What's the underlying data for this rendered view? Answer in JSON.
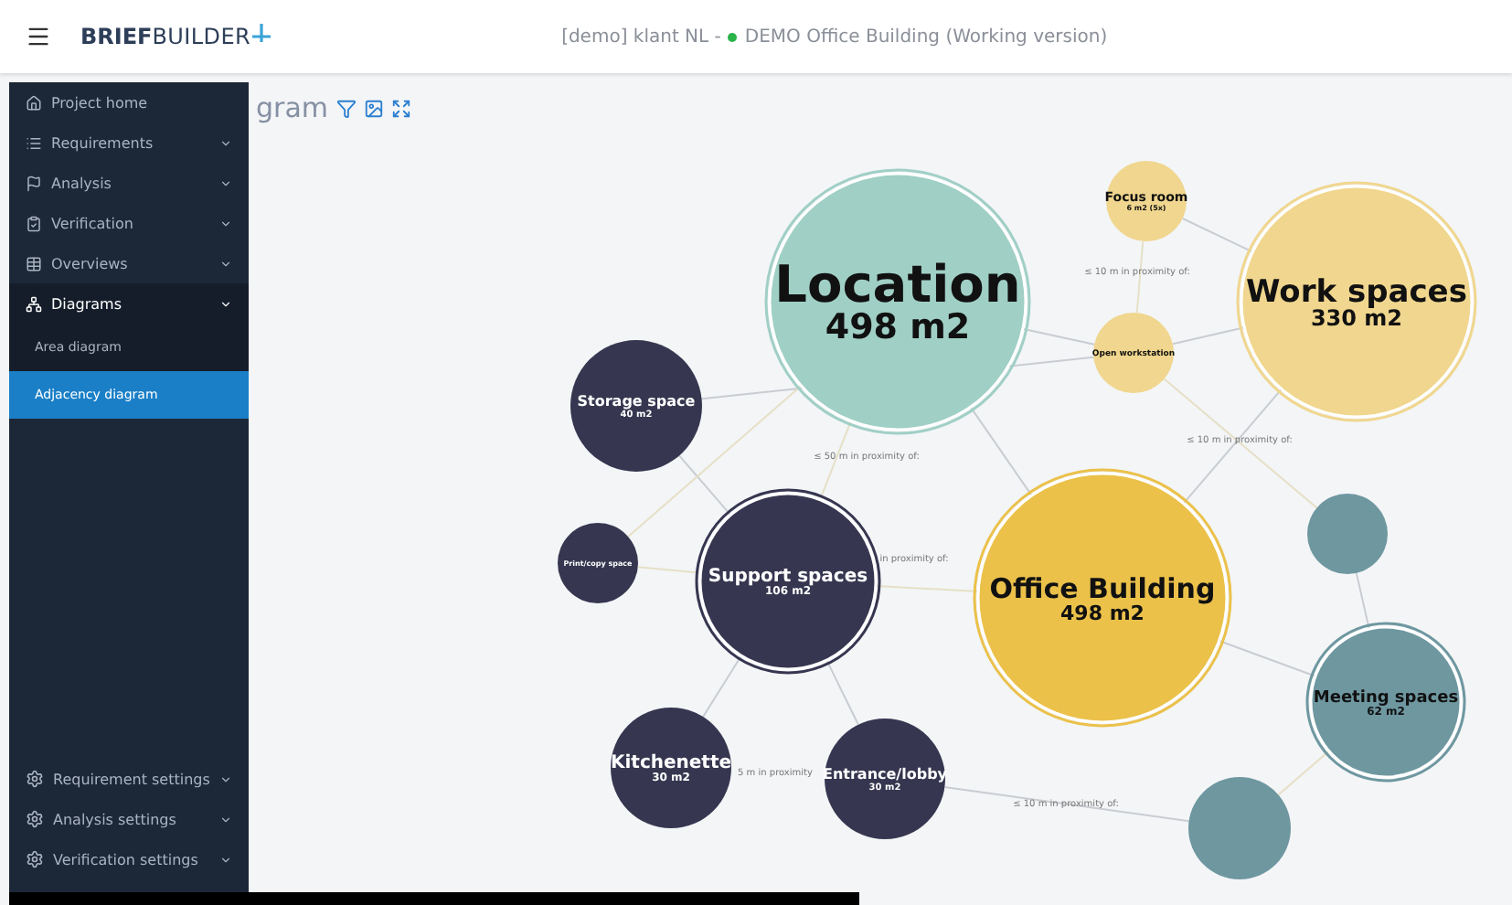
{
  "header": {
    "logo": {
      "bold": "BRIEF",
      "light": "BUILDER"
    },
    "project_prefix": "[demo] klant NL - ",
    "project_name": "DEMO Office Building (Working version)"
  },
  "page_title": "gram",
  "sidebar": {
    "items": [
      {
        "label": "Project home",
        "kind": "home",
        "expandable": false,
        "expanded": false
      },
      {
        "label": "Requirements",
        "kind": "list",
        "expandable": true,
        "expanded": false
      },
      {
        "label": "Analysis",
        "kind": "flag",
        "expandable": true,
        "expanded": false
      },
      {
        "label": "Verification",
        "kind": "clipboard",
        "expandable": true,
        "expanded": false
      },
      {
        "label": "Overviews",
        "kind": "table",
        "expandable": true,
        "expanded": false
      },
      {
        "label": "Diagrams",
        "kind": "diagram",
        "expandable": true,
        "expanded": true,
        "children": [
          {
            "label": "Area diagram",
            "selected": false
          },
          {
            "label": "Adjacency diagram",
            "selected": true
          }
        ]
      }
    ],
    "settings": [
      {
        "label": "Requirement settings"
      },
      {
        "label": "Analysis settings"
      },
      {
        "label": "Verification settings"
      }
    ]
  },
  "diagram": {
    "nodes": [
      {
        "label": "Location",
        "area": "498 m2",
        "color": "#a0cfc5",
        "group": true
      },
      {
        "label": "Work spaces",
        "area": "330 m2",
        "color": "#f0d68e",
        "group": true
      },
      {
        "label": "Focus room",
        "area": "6 m2 (5x)",
        "color": "#f0d68e",
        "group": false
      },
      {
        "label": "Open workstation",
        "color": "#f0d68e",
        "group": false
      },
      {
        "label": "Storage space",
        "area": "40 m2",
        "color": "#363650",
        "group": false
      },
      {
        "label": "Support spaces",
        "area": "106 m2",
        "color": "#363650",
        "group": true
      },
      {
        "label": "Print/copy space",
        "color": "#363650",
        "group": false
      },
      {
        "label": "Kitchenette",
        "area": "30 m2",
        "color": "#363650",
        "group": false
      },
      {
        "label": "Entrance/lobby",
        "area": "30 m2",
        "color": "#363650",
        "group": false
      },
      {
        "label": "Office Building",
        "area": "498 m2",
        "color": "#ebc14a",
        "group": true
      },
      {
        "color": "#6e97a0",
        "group": false
      },
      {
        "label": "Meeting spaces",
        "area": "62 m2",
        "color": "#6e97a0",
        "group": true
      },
      {
        "color": "#6e97a0",
        "group": false
      }
    ],
    "edge_labels": [
      "≤ 10 m in proximity of:",
      "≤ 10 m in proximity of:",
      "≤ 50 m in proximity of:",
      "in proximity of:",
      "5 m in proximity",
      "≤ 10 m in proximity of:"
    ]
  }
}
